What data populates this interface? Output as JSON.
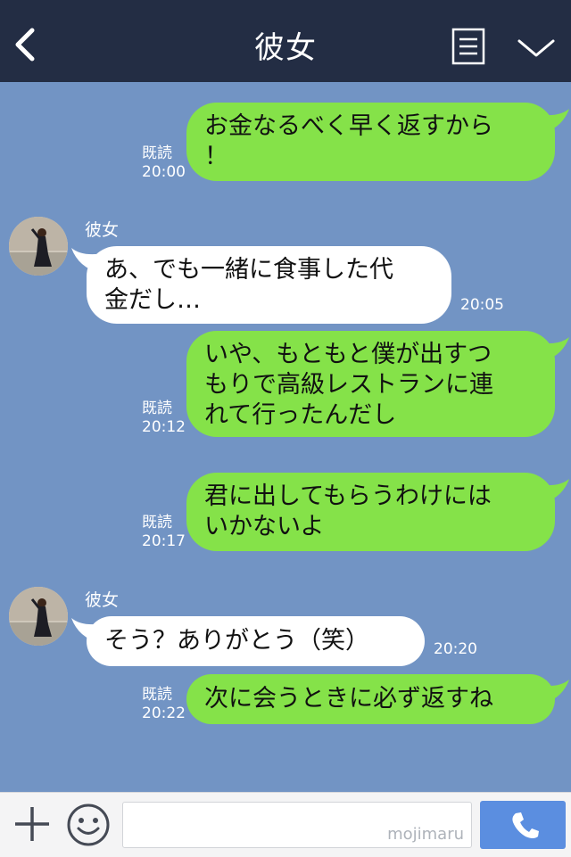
{
  "header": {
    "title": "彼女"
  },
  "messages": [
    {
      "dir": "out",
      "text": "お金なるべく早く返すから\n！",
      "read": "既読",
      "time": "20:00"
    },
    {
      "dir": "in",
      "sender": "彼女",
      "text": "あ、でも一緒に食事した代\n金だし…",
      "time": "20:05"
    },
    {
      "dir": "out",
      "text": "いや、もともと僕が出すつ\nもりで高級レストランに連\nれて行ったんだし",
      "read": "既読",
      "time": "20:12"
    },
    {
      "dir": "out",
      "text": "君に出してもらうわけには\nいかないよ",
      "read": "既読",
      "time": "20:17"
    },
    {
      "dir": "in",
      "sender": "彼女",
      "text": "そう？ありがとう（笑）",
      "time": "20:20"
    },
    {
      "dir": "out",
      "text": "次に会うときに必ず返すね",
      "read": "既読",
      "time": "20:22"
    }
  ],
  "input": {
    "watermark": "mojimaru"
  },
  "colors": {
    "header_bg": "#232d44",
    "chat_bg": "#7294c4",
    "outgoing_bubble": "#85e249",
    "incoming_bubble": "#ffffff",
    "call_button": "#5b8ee0"
  },
  "icons": {
    "back": "chevron-left-icon",
    "menu": "list-icon",
    "collapse": "chevron-down-icon",
    "plus": "plus-icon",
    "emoji": "smiley-icon",
    "call": "phone-icon"
  }
}
